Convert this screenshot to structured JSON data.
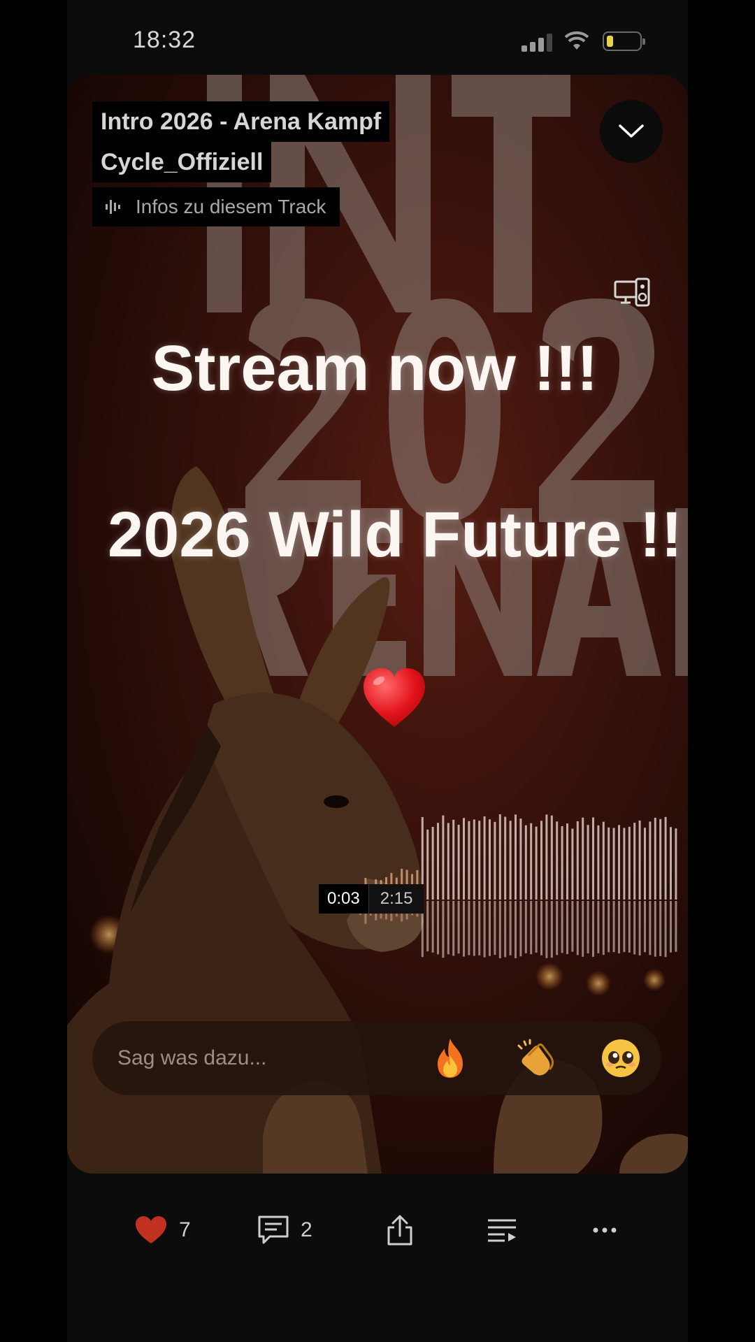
{
  "status_bar": {
    "time": "18:32",
    "battery_color": "#e9d44a"
  },
  "track": {
    "title_line1": "Intro 2026 -  Arena Kampf",
    "title_line2": "Cycle_Offiziell",
    "info_label": "Infos zu diesem Track"
  },
  "artwork": {
    "caption_1": "Stream now !!!",
    "caption_2": "2026 Wild Future !!",
    "emoji": "heart",
    "accent_color": "#6b2416"
  },
  "player": {
    "current_time": "0:03",
    "duration": "2:15",
    "progress_fraction": 0.022
  },
  "comment": {
    "placeholder": "Sag was dazu...",
    "reactions": [
      "fire-emoji",
      "clapping-hands-emoji",
      "pleading-face-emoji"
    ]
  },
  "toolbar": {
    "likes": "7",
    "comments": "2",
    "like_color": "#c0321f"
  }
}
